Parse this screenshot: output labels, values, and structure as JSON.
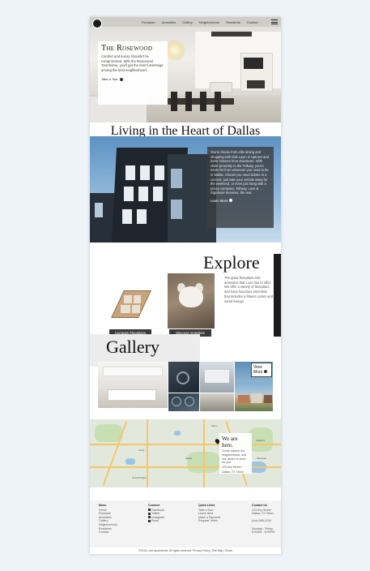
{
  "nav": {
    "links": [
      "Floorplan",
      "Amenities",
      "Gallery",
      "Neighborhood",
      "Residents",
      "Contact"
    ]
  },
  "hero": {
    "title": "The Rosewood",
    "text": "Comfort and luxury shouldn't be compromised. With the Rosewood Townhome, you'll get the best furnishings among the best neighborhood.",
    "tour_label": "Take a Tour"
  },
  "heart": {
    "heading": "Living in the Heart of Dallas",
    "text": "You're blocks from elite dining and shopping with Oak Lawn in Uptown and mere minutes from downtown. With close proximity to the Tollway, you're never far from wherever you need to be in Dallas. Should you need tickets to a concert, just take your vehicle away for the weekend, or even just hang with a pricey computer, Tollway, Love & Signature Services, the rest.",
    "learn_more": "Learn More"
  },
  "explore": {
    "title": "Explore",
    "text": "The great floorplans and amenities that Luxe has to offer. We offer a variety of floorplans, and have luxurious amenities that includes a fitness center and social lounge.",
    "floorplans_button": "Compare Floorplans",
    "amenities_button": "Discover Amenities"
  },
  "gallery": {
    "title": "Gallery",
    "view_more": "View More"
  },
  "map": {
    "title": "We are here.",
    "text": "Come explore the neighborhood, and see what's in store for you.",
    "address_line1": "123 Any Street",
    "address_line2": "Dallas, TX 75xxx",
    "labels": [
      "Plano",
      "Garland",
      "Irving",
      "Dallas",
      "Mesquite",
      "Grand Prairie"
    ]
  },
  "footer": {
    "menu_heading": "Menu",
    "menu_items": [
      "Home",
      "Floorplan",
      "Amenities",
      "Gallery",
      "Neighborhood",
      "Residents",
      "Contact"
    ],
    "connect_heading": "Connect",
    "connect_items": [
      "Facebook",
      "Twitter",
      "Instagram",
      "Email"
    ],
    "quick_heading": "Quick Links",
    "quick_items": [
      "Take a Tour",
      "Leave Area",
      "Make a Payment",
      "Request Terms"
    ],
    "contact_heading": "Contact Us",
    "contact_items": [
      "123 Any Street",
      "Dallas, TX 75xxx",
      "",
      "(xxx) 555-1234",
      "",
      "Monday - Friday",
      "8:00AM - 6:00PM"
    ],
    "copyright": "©2018 Luxe Apartments. All rights reserved. Privacy Policy | Site Map | Share"
  },
  "colors": {
    "accent": "#1c1c1c",
    "panel": "#3a3e42",
    "sky": "#6b9dca"
  }
}
